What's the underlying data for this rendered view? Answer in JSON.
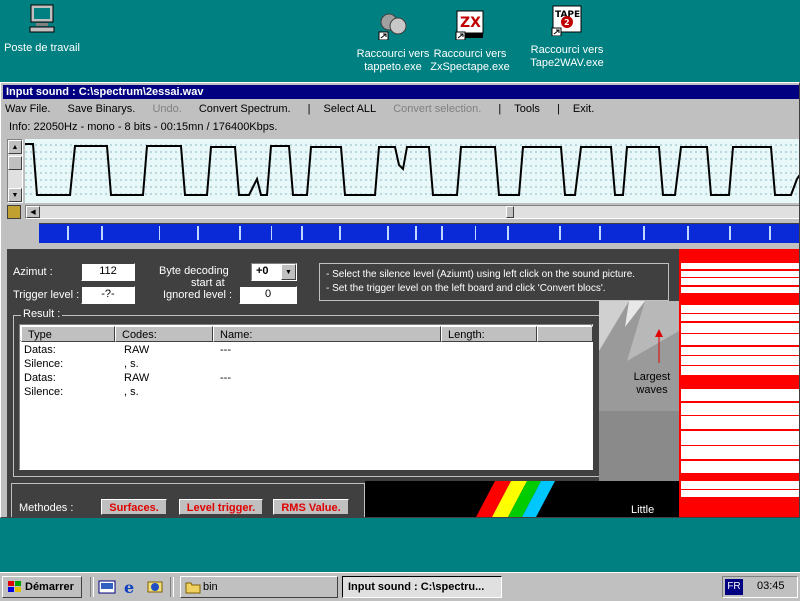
{
  "desktop": {
    "icons": [
      {
        "label": "Poste de travail"
      },
      {
        "label": "Raccourci vers tappeto.exe"
      },
      {
        "label": "Raccourci vers ZxSpectape.exe"
      },
      {
        "label": "Raccourci vers Tape2WAV.exe"
      }
    ]
  },
  "window": {
    "title": "Input sound : C:\\spectrum\\2essai.wav",
    "menu": {
      "wav_file": "Wav File.",
      "save_binarys": "Save Binarys.",
      "undo": "Undo.",
      "convert_spectrum": "Convert Spectrum.",
      "select_all": "Select ALL",
      "convert_selection": "Convert selection.",
      "tools": "Tools",
      "exit": "Exit."
    },
    "info": "Info: 22050Hz - mono - 8 bits - 00:15mn / 176400Kbps.",
    "controls": {
      "azimut_label": "Azimut :",
      "azimut_value": "112",
      "trigger_label": "Trigger level :",
      "trigger_value": "-?-",
      "byte_decoding_label": "Byte decoding",
      "start_at_label": "start at",
      "byte_decoding_value": "+0",
      "ignored_label": "Ignored level :",
      "ignored_value": "0"
    },
    "hint": {
      "line1": "- Select the silence level (Aziumt) using left click on the sound picture.",
      "line2": "- Set the trigger level on the left board and click 'Convert blocs'."
    },
    "result": {
      "group_label": "Result :",
      "columns": [
        "Type",
        "Codes:",
        "Name:",
        "Length:"
      ],
      "rows": [
        {
          "type": "Datas:",
          "codes": "RAW",
          "name": "---",
          "length": ""
        },
        {
          "type": "Silence:",
          "codes": ", s.",
          "name": "",
          "length": ""
        },
        {
          "type": "Datas:",
          "codes": "RAW",
          "name": "---",
          "length": ""
        },
        {
          "type": "Silence:",
          "codes": ", s.",
          "name": "",
          "length": ""
        }
      ]
    },
    "side": {
      "largest": "Largest waves",
      "little": "Little"
    },
    "methods": {
      "label": "Methodes :",
      "surfaces": "Surfaces.",
      "level_trigger": "Level trigger.",
      "rms_value": "RMS Value."
    }
  },
  "taskbar": {
    "start": "Démarrer",
    "folder": "bin",
    "active_task": "Input sound : C:\\spectru...",
    "lang": "FR",
    "clock": "03:45"
  },
  "colors": {
    "desktop": "#008080",
    "titlebar": "#000080",
    "wave_bg": "#e8f8f8",
    "accent_red": "#e00000"
  }
}
